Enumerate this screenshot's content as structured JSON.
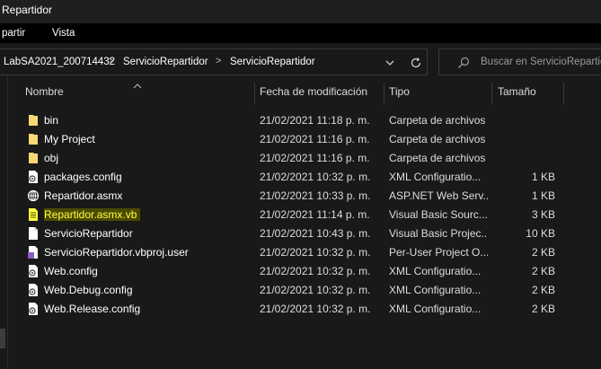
{
  "window": {
    "title": "Repartidor"
  },
  "ribbon": {
    "tabs": [
      "partir",
      "Vista"
    ]
  },
  "address": {
    "crumbs": [
      "LabSA2021_200714432",
      "ServicioRepartidor",
      "ServicioRepartidor"
    ],
    "separator": ">"
  },
  "search": {
    "placeholder": "Buscar en ServicioRepartidor"
  },
  "columns": {
    "name": "Nombre",
    "date": "Fecha de modificación",
    "type": "Tipo",
    "size": "Tamaño"
  },
  "files": [
    {
      "name": "bin",
      "date": "21/02/2021 11:18 p. m.",
      "type": "Carpeta de archivos",
      "size": "",
      "icon": "folder-icon"
    },
    {
      "name": "My Project",
      "date": "21/02/2021 11:16 p. m.",
      "type": "Carpeta de archivos",
      "size": "",
      "icon": "folder-icon"
    },
    {
      "name": "obj",
      "date": "21/02/2021 11:16 p. m.",
      "type": "Carpeta de archivos",
      "size": "",
      "icon": "folder-icon"
    },
    {
      "name": "packages.config",
      "date": "21/02/2021 10:32 p. m.",
      "type": "XML Configuratio...",
      "size": "1 KB",
      "icon": "config-file-icon"
    },
    {
      "name": "Repartidor.asmx",
      "date": "21/02/2021 10:33 p. m.",
      "type": "ASP.NET Web Serv...",
      "size": "1 KB",
      "icon": "web-service-file-icon"
    },
    {
      "name": "Repartidor.asmx.vb",
      "date": "21/02/2021 11:14 p. m.",
      "type": "Visual Basic Sourc...",
      "size": "3 KB",
      "icon": "vb-source-file-icon"
    },
    {
      "name": "ServicioRepartidor",
      "date": "21/02/2021 10:43 p. m.",
      "type": "Visual Basic Projec...",
      "size": "10 KB",
      "icon": "file-icon"
    },
    {
      "name": "ServicioRepartidor.vbproj.user",
      "date": "21/02/2021 10:32 p. m.",
      "type": "Per-User Project O...",
      "size": "2 KB",
      "icon": "vs-user-file-icon"
    },
    {
      "name": "Web.config",
      "date": "21/02/2021 10:32 p. m.",
      "type": "XML Configuratio...",
      "size": "2 KB",
      "icon": "config-file-icon"
    },
    {
      "name": "Web.Debug.config",
      "date": "21/02/2021 10:32 p. m.",
      "type": "XML Configuratio...",
      "size": "2 KB",
      "icon": "config-file-icon"
    },
    {
      "name": "Web.Release.config",
      "date": "21/02/2021 10:32 p. m.",
      "type": "XML Configuratio...",
      "size": "2 KB",
      "icon": "config-file-icon"
    }
  ],
  "colors": {
    "background": "#191919",
    "folder": "#f8d775",
    "highlight_text": "#ffff44",
    "highlight_bg": "#4a4a00"
  }
}
